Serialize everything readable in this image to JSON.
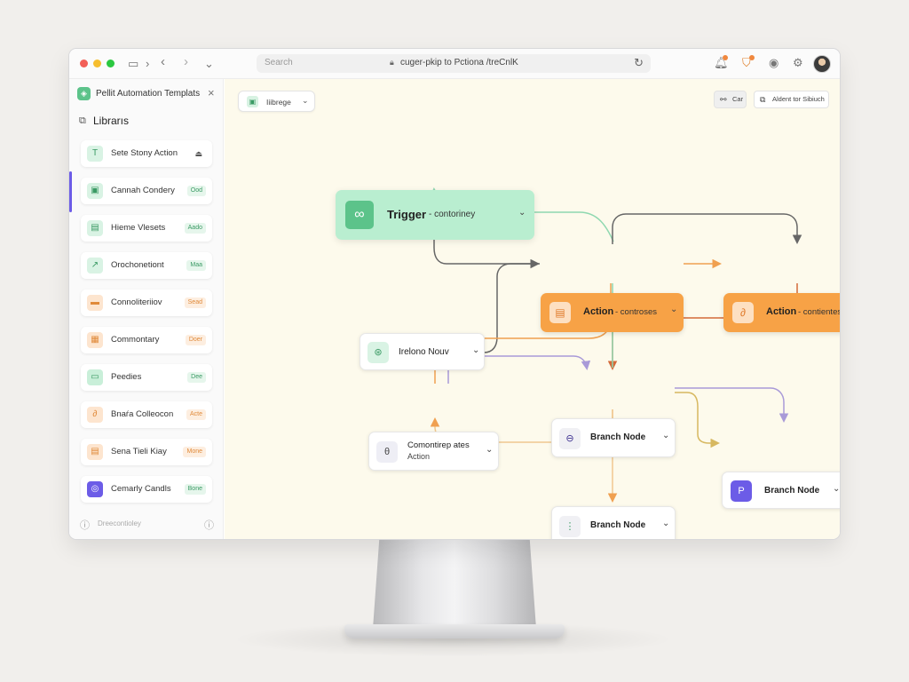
{
  "browser": {
    "search_placeholder": "Search",
    "url": "cuger-pkip to Pctiona /treCnlK"
  },
  "sidebar": {
    "title": "Pellit Automation Templats",
    "section_label": "Librarıs",
    "items": [
      {
        "label": "Sete Stony Action",
        "tag": "",
        "icon_bg": "#d9f3e4",
        "icon_color": "#3a9a64",
        "icon": "T"
      },
      {
        "label": "Cannah Condery",
        "tag": "Ood",
        "icon_bg": "#d9f3e4",
        "icon_color": "#3a9a64",
        "icon": "▣"
      },
      {
        "label": "Hieme Vlesets",
        "tag": "Aado",
        "icon_bg": "#d9f3e4",
        "icon_color": "#3a9a64",
        "icon": "▤"
      },
      {
        "label": "Orochonetiont",
        "tag": "Maa",
        "icon_bg": "#d9f3e4",
        "icon_color": "#3a9a64",
        "icon": "↗"
      },
      {
        "label": "Connoliteriiov",
        "tag": "Sead",
        "icon_bg": "#fde5cf",
        "icon_color": "#e08a3a",
        "icon": "▬"
      },
      {
        "label": "Commontary",
        "tag": "Doer",
        "icon_bg": "#fde5cf",
        "icon_color": "#e08a3a",
        "icon": "▦"
      },
      {
        "label": "Peedies",
        "tag": "Dee",
        "icon_bg": "#c9efd9",
        "icon_color": "#3a9a64",
        "icon": "▭"
      },
      {
        "label": "Bnaŕa Colleocon",
        "tag": "Acte",
        "icon_bg": "#fde5cf",
        "icon_color": "#e08a3a",
        "icon": "∂"
      },
      {
        "label": "Sena Tieli Kiay",
        "tag": "Mone",
        "icon_bg": "#fde5cf",
        "icon_color": "#e08a3a",
        "icon": "▤"
      },
      {
        "label": "Cemarly Candls",
        "tag": "Bone",
        "icon_bg": "#6c5ce7",
        "icon_color": "#ffffff",
        "icon": "◎"
      }
    ],
    "footer_text": "Dreecontioley"
  },
  "canvas": {
    "library_dropdown": "Iiibrege",
    "btn_1": "Car",
    "btn_2": "Aldent tor Sibiuch"
  },
  "nodes": {
    "trigger": {
      "title": "Trigger",
      "sub": "- contoriney"
    },
    "action1": {
      "title": "Action",
      "sub": "- controses"
    },
    "action2": {
      "title": "Action",
      "sub": "- contientes"
    },
    "ireland": {
      "title": "Irelono Nouv"
    },
    "composite": {
      "title": "Comontirep ates",
      "sub": "Action"
    },
    "branch1": {
      "title": "Branch Node"
    },
    "branch2": {
      "title": "Branch Node"
    },
    "branch3": {
      "title": "Branch Node"
    }
  },
  "colors": {
    "trigger_bg": "#b9eed0",
    "action_bg": "#f7a246",
    "canvas_bg": "#fdfaec",
    "accent_purple": "#6c5ce7"
  }
}
